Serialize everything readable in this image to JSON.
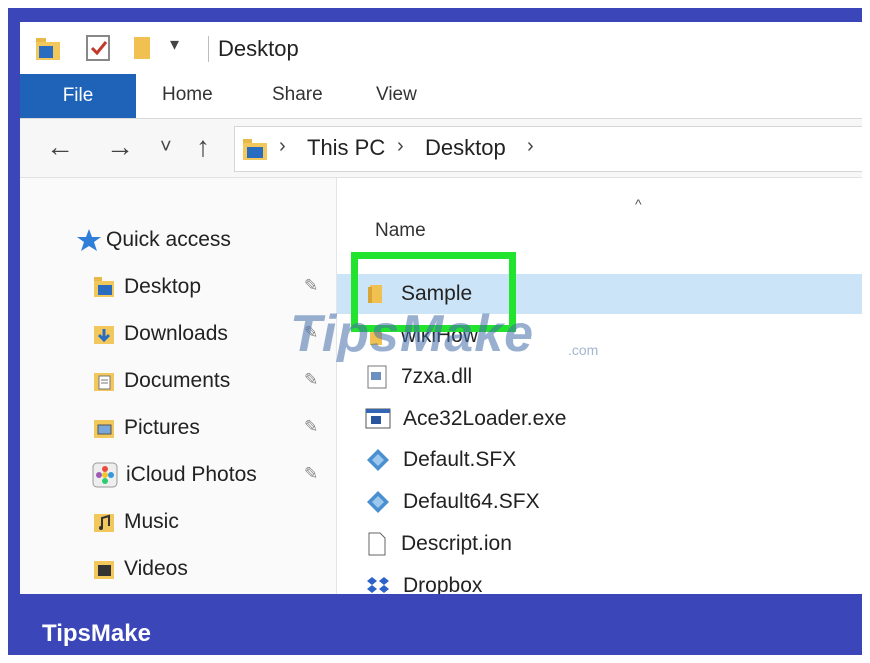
{
  "window": {
    "title": "Desktop",
    "quick_access_dropdown": "▾"
  },
  "ribbon": {
    "tabs": [
      {
        "label": "File",
        "active": true
      },
      {
        "label": "Home"
      },
      {
        "label": "Share"
      },
      {
        "label": "View"
      }
    ]
  },
  "address": {
    "back": "←",
    "forward": "→",
    "recent": "˅",
    "up": "↑",
    "crumbs": [
      "This PC",
      "Desktop"
    ],
    "sep": "›"
  },
  "nav": {
    "quick_access": "Quick access",
    "items": [
      {
        "label": "Desktop",
        "icon": "desktop-folder-icon",
        "pinned": true
      },
      {
        "label": "Downloads",
        "icon": "downloads-folder-icon",
        "pinned": true
      },
      {
        "label": "Documents",
        "icon": "documents-folder-icon",
        "pinned": true
      },
      {
        "label": "Pictures",
        "icon": "pictures-folder-icon",
        "pinned": true
      },
      {
        "label": "iCloud Photos",
        "icon": "icloud-photos-icon",
        "pinned": true
      },
      {
        "label": "Music",
        "icon": "music-folder-icon",
        "pinned": false
      },
      {
        "label": "Videos",
        "icon": "videos-folder-icon",
        "pinned": false
      }
    ],
    "pin_glyph": "✎"
  },
  "content": {
    "column_header": "Name",
    "sort_indicator": "^",
    "files": [
      {
        "name": "Sample",
        "icon": "folder-icon",
        "selected": true
      },
      {
        "name": "wikiHow",
        "icon": "folder-icon"
      },
      {
        "name": "7zxa.dll",
        "icon": "dll-icon"
      },
      {
        "name": "Ace32Loader.exe",
        "icon": "exe-icon"
      },
      {
        "name": "Default.SFX",
        "icon": "sfx-icon"
      },
      {
        "name": "Default64.SFX",
        "icon": "sfx-icon"
      },
      {
        "name": "Descript.ion",
        "icon": "document-icon"
      },
      {
        "name": "Dropbox",
        "icon": "dropbox-icon"
      }
    ]
  },
  "watermark": {
    "text": "TipsMake",
    "suffix": ".com"
  },
  "brand": "TipsMake",
  "colors": {
    "frame": "#3b46b8",
    "file_tab": "#1e63b8",
    "selection": "#cce4f7",
    "highlight": "#22e32e"
  }
}
